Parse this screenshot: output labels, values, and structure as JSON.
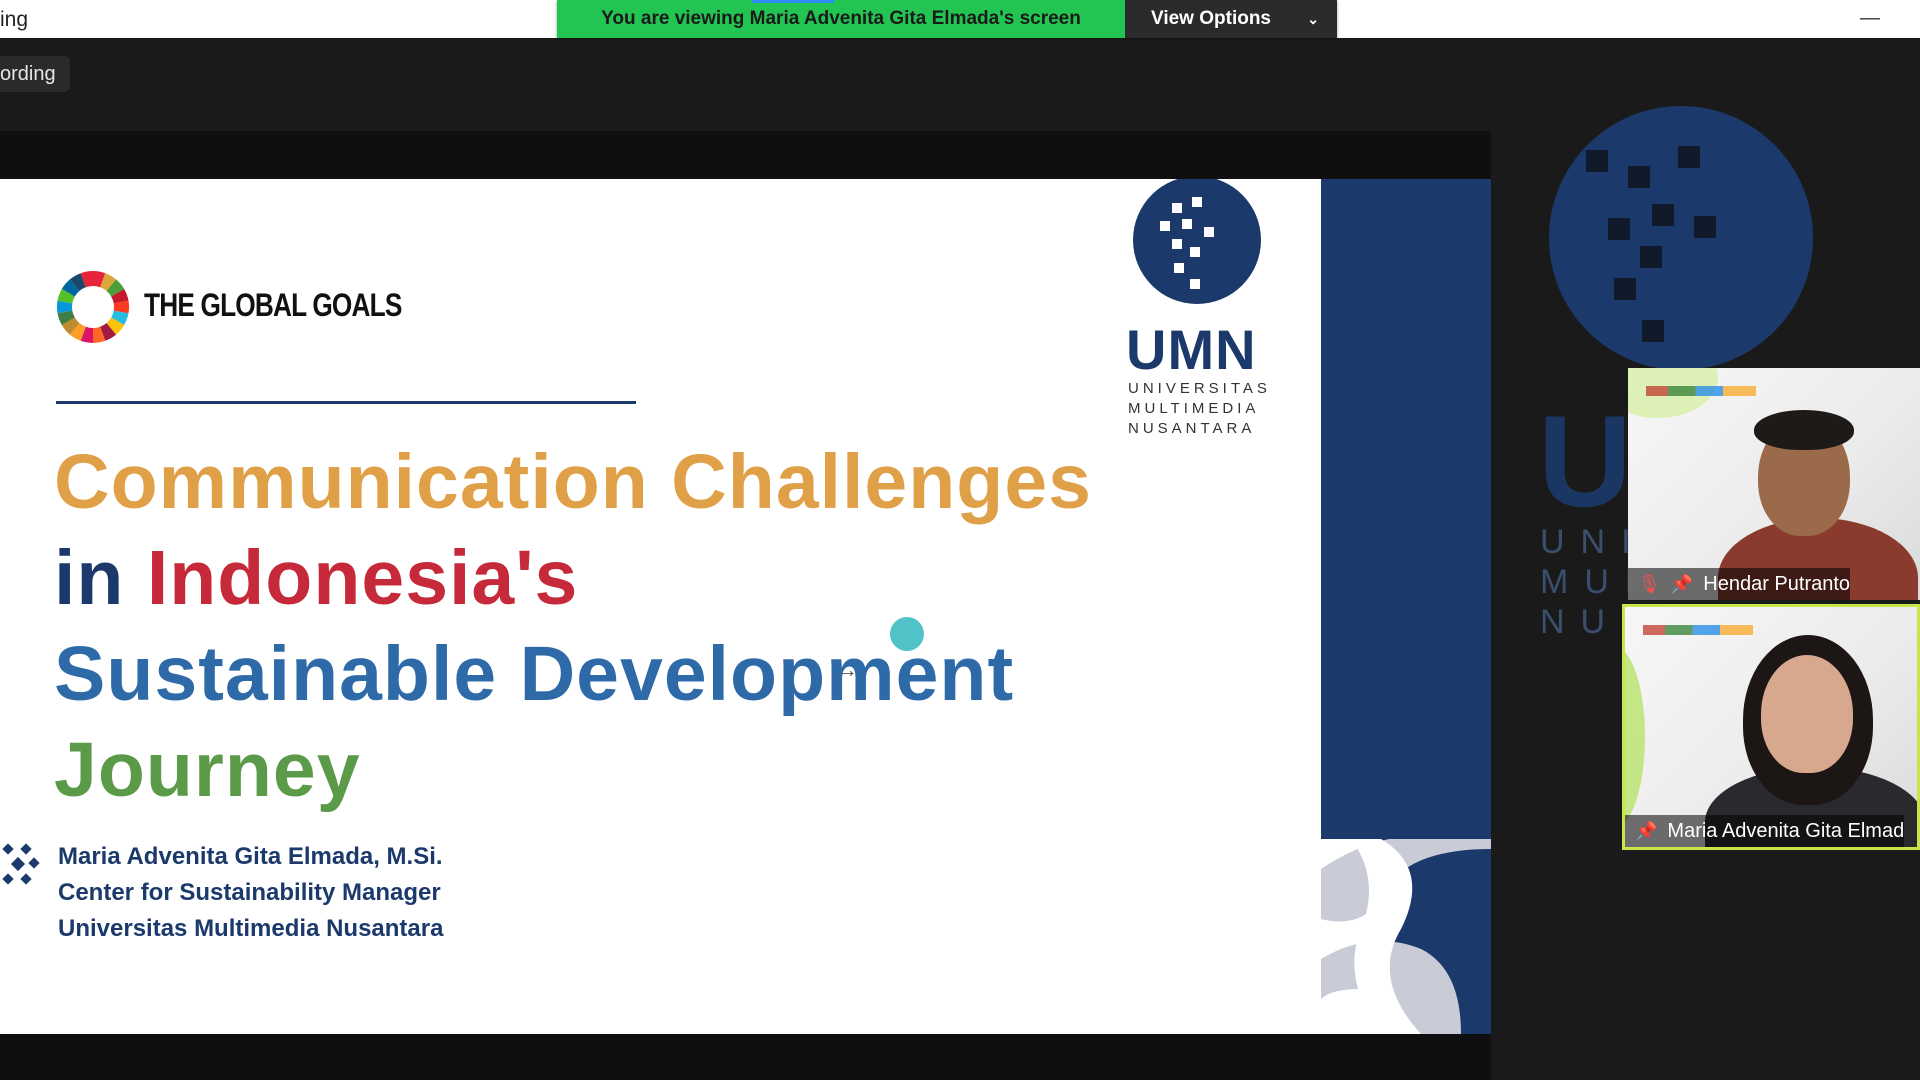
{
  "topbar": {
    "left_fragment": "ing",
    "share_banner": "You are viewing Maria Advenita Gita Elmada's screen",
    "view_options": "View Options",
    "minimize": "—"
  },
  "recording": {
    "label": "ording"
  },
  "slide": {
    "global_goals": "THE GLOBAL GOALS",
    "umn": {
      "word": "UMN",
      "line1": "UNIVERSITAS",
      "line2": "MULTIMEDIA",
      "line3": "NUSANTARA"
    },
    "title": {
      "line1": "Communication Challenges",
      "line2_a": "in",
      "line2_b": "Indonesia's",
      "line3": "Sustainable Development",
      "line4": "Journey"
    },
    "author": {
      "name": "Maria Advenita Gita Elmada, M.Si.",
      "role": "Center for Sustainability Manager",
      "org": "Universitas Multimedia Nusantara"
    },
    "colors": {
      "orange": "#e0a048",
      "navy": "#1b3a6b",
      "red": "#c62a3a",
      "blue": "#2e6aa8",
      "green": "#5a9a48"
    }
  },
  "background_logo": {
    "word": "UMN",
    "line1": "UNIVERSITAS",
    "line2": "MULTIMEDIA",
    "line3": "NUSANTARA"
  },
  "participants": [
    {
      "name": "Hendar Putranto",
      "muted": true,
      "pinned": true
    },
    {
      "name": "Maria Advenita Gita Elmad",
      "muted": false,
      "pinned": true,
      "active_speaker": true
    }
  ]
}
